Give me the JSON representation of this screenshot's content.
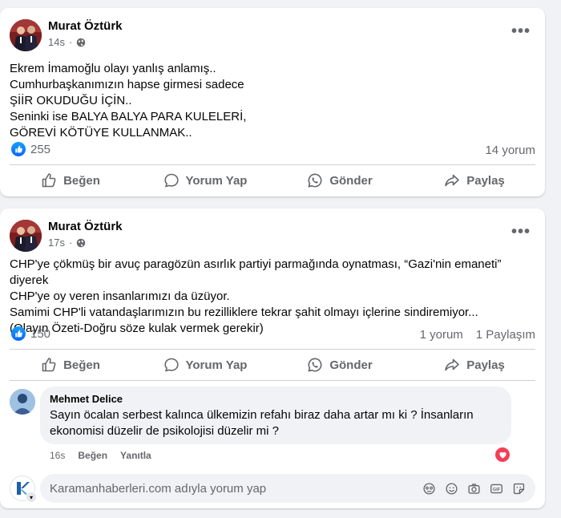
{
  "posts": [
    {
      "author": "Murat Öztürk",
      "time": "14s",
      "text_lines": [
        "Ekrem İmamoğlu olayı yanlış anlamış..",
        "Cumhurbaşkanımızın hapse girmesi sadece",
        "ŞİİR OKUDUĞU İÇİN..",
        "Seninki ise BALYA BALYA PARA KULELERİ,",
        "GÖREVİ KÖTÜYE KULLANMAK.."
      ],
      "reactions_count": "255",
      "comments_count": "14 yorum"
    },
    {
      "author": "Murat Öztürk",
      "time": "17s",
      "text_lines": [
        "CHP'ye çökmüş bir avuç paragözün asırlık partiyi parmağında oynatması, “Gazi'nin emaneti” diyerek",
        "CHP'ye oy veren insanlarımızı da üzüyor.",
        "Samimi CHP'li vatandaşlarımızın bu rezilliklere tekrar şahit olmayı içlerine sindiremiyor...",
        "(Olayın Özeti-Doğru söze kulak vermek gerekir)"
      ],
      "reactions_count": "150",
      "comments_count": "1 yorum",
      "shares_count": "1 Paylaşım",
      "comment": {
        "author": "Mehmet Delice",
        "text_lines": [
          "Sayın öcalan serbest kalınca ülkemizin refahı biraz daha artar mı ki ? İnsanların",
          "ekonomisi düzelir de psikolojisi düzelir mi ?"
        ],
        "time": "16s",
        "like_label": "Beğen",
        "reply_label": "Yanıtla"
      },
      "comment_input_placeholder": "Karamanhaberleri.com adıyla yorum yap"
    }
  ],
  "actions": {
    "like": "Beğen",
    "comment": "Yorum Yap",
    "send": "Gönder",
    "share": "Paylaş"
  },
  "colors": {
    "background": "#f0f2f5",
    "card": "#ffffff",
    "secondary_text": "#65676b",
    "like_blue": "#0866ff",
    "love_red": "#f33e58"
  },
  "icons": [
    "more-icon",
    "globe-icon",
    "like-reaction-icon",
    "thumbs-up-icon",
    "comment-icon",
    "whatsapp-icon",
    "share-icon",
    "love-reaction-icon",
    "emoji-icon",
    "camera-icon",
    "gif-icon",
    "sticker-icon",
    "avatar-icon"
  ]
}
